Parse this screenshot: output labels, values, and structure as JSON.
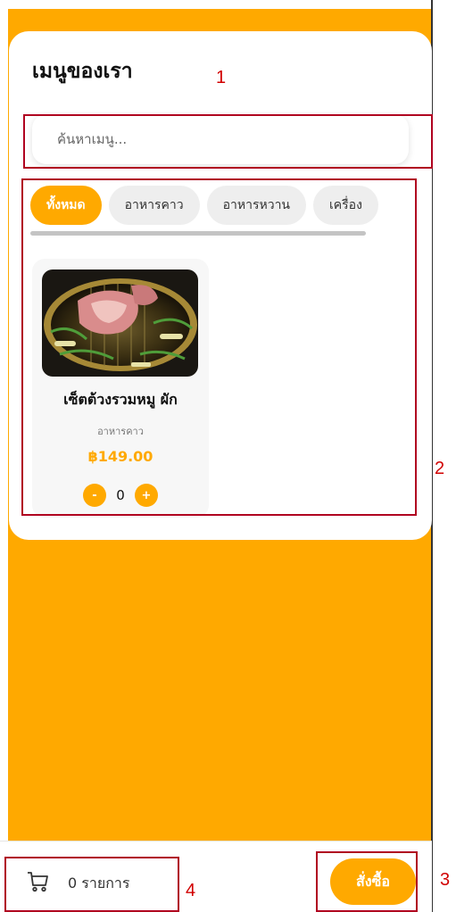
{
  "header": {
    "title": "เมนูของเรา"
  },
  "search": {
    "placeholder": "ค้นหาเมนู..."
  },
  "categories": [
    {
      "label": "ทั้งหมด",
      "active": true
    },
    {
      "label": "อาหารคาว",
      "active": false
    },
    {
      "label": "อาหารหวาน",
      "active": false
    },
    {
      "label": "เครื่อง",
      "active": false
    }
  ],
  "products": [
    {
      "name": "เซ็ตต้วงรวมหมู ผัก",
      "category": "อาหารคาว",
      "price": "฿149.00",
      "quantity": "0",
      "minus_label": "-",
      "plus_label": "+"
    }
  ],
  "footer": {
    "cart_label": "0 รายการ",
    "order_label": "สั่งซื้อ"
  },
  "annotations": [
    "1",
    "2",
    "3",
    "4"
  ],
  "colors": {
    "accent": "#FFA900",
    "annotation": "#b00020"
  },
  "icons": {
    "cart": "cart-icon"
  }
}
